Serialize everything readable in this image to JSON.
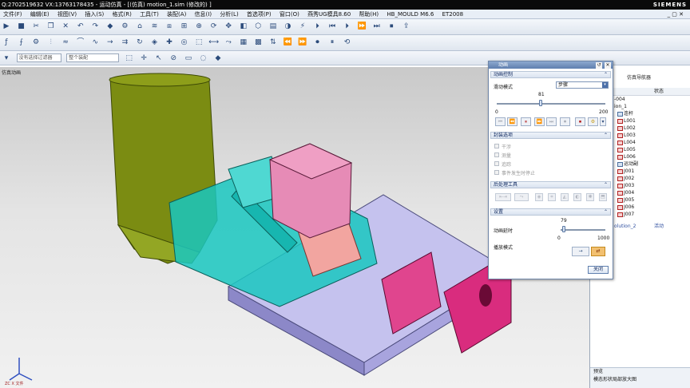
{
  "titlebar": {
    "text": "Q:2702519632  VX:13763178435 - 运动仿真 - [(仿真) motion_1.sim  (修改的) ]",
    "brand": "SIEMENS"
  },
  "menubar": {
    "items": [
      "文件(F)",
      "编辑(E)",
      "视图(V)",
      "插入(S)",
      "格式(R)",
      "工具(T)",
      "装配(A)",
      "信息(I)",
      "分析(L)",
      "首选项(P)",
      "窗口(O)",
      "燕秀UG模具8.60",
      "帮助(H)",
      "HB_MOULD M6.6",
      "ET2008"
    ],
    "window_controls": "_ ▢ ✕"
  },
  "toolbar3": {
    "filter_placeholder": "整个装配",
    "filter_value": "没有选择过滤器"
  },
  "viewport": {
    "label": "仿真动画"
  },
  "dialog": {
    "title": "动画",
    "title_buttons": [
      "↺",
      "✕"
    ],
    "section_control": "动画控制",
    "slide_mode_label": "滑动模式",
    "slide_mode_value": "步骤",
    "slider_value": "81",
    "slider_min": "0",
    "slider_max": "200",
    "slider_position": 0.405,
    "play_buttons": [
      "⏮",
      "⏪",
      "⏸",
      "⏩",
      "⏭",
      "⏺",
      "⏹",
      "⚙",
      "▾"
    ],
    "section_package": "封装选项",
    "package_options": [
      "干涉",
      "测量",
      "追踪",
      "事件发生时停止"
    ],
    "section_post": "后处理工具",
    "section_settings": "设置",
    "delay_label": "动画延时",
    "delay_value": "79",
    "delay_min": "0",
    "delay_max": "1000",
    "delay_position": 0.079,
    "playback_label": "播放模式",
    "close_label": "关闭"
  },
  "navigator": {
    "header": "仿真导航器",
    "col_name": "名称",
    "col_status": "状态",
    "rows": [
      {
        "label": "-004",
        "status": ""
      },
      {
        "label": "ion_1",
        "status": ""
      },
      {
        "label": "连杆",
        "status": ""
      },
      {
        "label": "L001",
        "status": ""
      },
      {
        "label": "L002",
        "status": ""
      },
      {
        "label": "L003",
        "status": ""
      },
      {
        "label": "L004",
        "status": ""
      },
      {
        "label": "L005",
        "status": ""
      },
      {
        "label": "L006",
        "status": ""
      },
      {
        "label": "运动副",
        "status": ""
      },
      {
        "label": "J001",
        "status": ""
      },
      {
        "label": "J002",
        "status": ""
      },
      {
        "label": "J003",
        "status": ""
      },
      {
        "label": "J004",
        "status": ""
      },
      {
        "label": "J005",
        "status": ""
      },
      {
        "label": "J006",
        "status": ""
      },
      {
        "label": "J007",
        "status": ""
      },
      {
        "label": "olution_2",
        "status": "活动"
      }
    ],
    "bottom": [
      "预览",
      "模态形状局部放大图"
    ]
  },
  "colors": {
    "housing": "#7b8c12",
    "teal": "#19c7c0",
    "pink": "#e68bb6",
    "magenta": "#d92c7e",
    "lavender": "#c5c2ee",
    "salmon": "#f2a5a0"
  }
}
